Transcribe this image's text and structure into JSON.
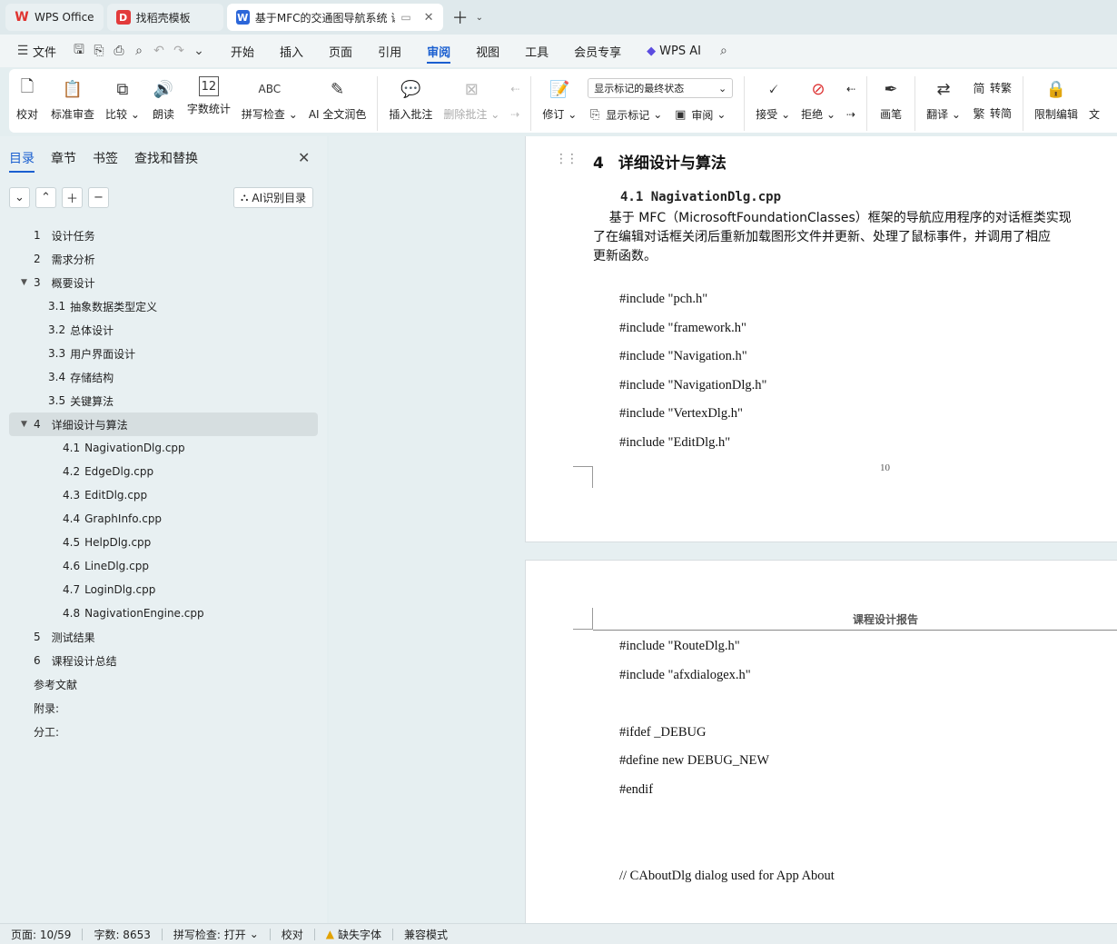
{
  "tabs": [
    {
      "label": "WPS Office",
      "icon": "wps-logo-icon",
      "active": false
    },
    {
      "label": "找稻壳模板",
      "icon": "docer-logo-icon",
      "active": false
    },
    {
      "label": "基于MFC的交通图导航系统 课",
      "icon": "word-doc-icon",
      "active": true
    }
  ],
  "menu": {
    "file": "文件",
    "items": [
      "开始",
      "插入",
      "页面",
      "引用",
      "审阅",
      "视图",
      "工具",
      "会员专享"
    ],
    "active": "审阅",
    "wps_ai": "WPS AI"
  },
  "ribbon": {
    "proofread": "校对",
    "standard_review": "标准审查",
    "compare": "比较",
    "read_aloud": "朗读",
    "word_count": "字数统计",
    "spell_check": "拼写检查",
    "ai_polish": "AI 全文润色",
    "insert_comment": "插入批注",
    "delete_comment": "删除批注",
    "markup_select": "显示标记的最终状态",
    "track_changes": "修订",
    "show_markup": "显示标记",
    "review": "审阅",
    "accept": "接受",
    "reject": "拒绝",
    "pen": "画笔",
    "translate": "翻译",
    "to_traditional": "转繁",
    "to_simplified": "转简",
    "restrict_edit": "限制编辑",
    "more": "文"
  },
  "left_panel": {
    "tabs": [
      "目录",
      "章节",
      "书签",
      "查找和替换"
    ],
    "active_tab": "目录",
    "ai_toc_button": "AI识别目录",
    "toc": [
      {
        "num": "1",
        "title": "设计任务",
        "level": 1
      },
      {
        "num": "2",
        "title": "需求分析",
        "level": 1
      },
      {
        "num": "3",
        "title": "概要设计",
        "level": 1,
        "expanded": true
      },
      {
        "num": "3.1",
        "title": "抽象数据类型定义",
        "level": 2
      },
      {
        "num": "3.2",
        "title": "总体设计",
        "level": 2
      },
      {
        "num": "3.3",
        "title": "用户界面设计",
        "level": 2
      },
      {
        "num": "3.4",
        "title": "存储结构",
        "level": 2
      },
      {
        "num": "3.5",
        "title": "关键算法",
        "level": 2
      },
      {
        "num": "4",
        "title": "详细设计与算法",
        "level": 1,
        "expanded": true,
        "active": true
      },
      {
        "num": "4.1",
        "title": "NagivationDlg.cpp",
        "level": 3
      },
      {
        "num": "4.2",
        "title": "EdgeDlg.cpp",
        "level": 3
      },
      {
        "num": "4.3",
        "title": "EditDlg.cpp",
        "level": 3
      },
      {
        "num": "4.4",
        "title": "GraphInfo.cpp",
        "level": 3
      },
      {
        "num": "4.5",
        "title": "HelpDlg.cpp",
        "level": 3
      },
      {
        "num": "4.6",
        "title": "LineDlg.cpp",
        "level": 3
      },
      {
        "num": "4.7",
        "title": "LoginDlg.cpp",
        "level": 3
      },
      {
        "num": "4.8",
        "title": "NagivationEngine.cpp",
        "level": 3
      },
      {
        "num": "5",
        "title": "测试结果",
        "level": 1
      },
      {
        "num": "6",
        "title": "课程设计总结",
        "level": 1
      },
      {
        "num": "",
        "title": "参考文献",
        "level": 1
      },
      {
        "num": "",
        "title": "附录:",
        "level": 1
      },
      {
        "num": "",
        "title": "分工:",
        "level": 1
      }
    ]
  },
  "document": {
    "page1": {
      "heading_num": "4",
      "heading": "详细设计与算法",
      "subheading": "4.1 NagivationDlg.cpp",
      "paragraph": [
        "    基于 MFC（MicrosoftFoundationClasses）框架的导航应用程序的对话框类实现",
        "了在编辑对话框关闭后重新加载图形文件并更新、处理了鼠标事件，并调用了相应",
        "更新函数。"
      ],
      "code": [
        "#include \"pch.h\"",
        "#include \"framework.h\"",
        "#include \"Navigation.h\"",
        "#include \"NavigationDlg.h\"",
        "#include \"VertexDlg.h\"",
        "#include \"EditDlg.h\""
      ],
      "page_number": "10"
    },
    "page2": {
      "header": "课程设计报告",
      "code": [
        "#include \"RouteDlg.h\"",
        "#include \"afxdialogex.h\"",
        "",
        "#ifdef _DEBUG",
        "#define new DEBUG_NEW",
        "#endif",
        "",
        "",
        "// CAboutDlg dialog used for App About"
      ]
    }
  },
  "status": {
    "page": "页面: 10/59",
    "words": "字数: 8653",
    "spell": "拼写检查: 打开",
    "proof": "校对",
    "missing_font": "缺失字体",
    "compat": "兼容模式"
  },
  "colors": {
    "accent": "#1a5fd0",
    "wps_red": "#e0332f",
    "docer_red": "#e23b3b",
    "word_blue": "#2b66d9"
  }
}
